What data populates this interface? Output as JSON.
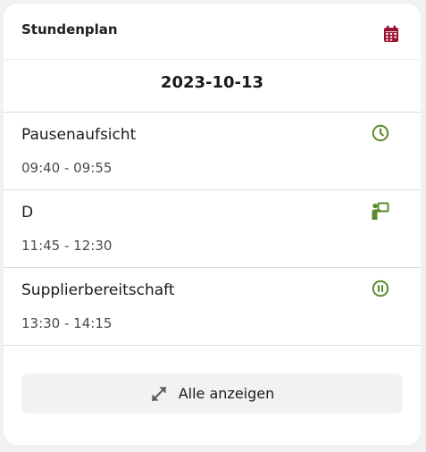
{
  "widget": {
    "title": "Stundenplan",
    "header_icon": "calendar-icon",
    "date": "2023-10-13"
  },
  "entries": [
    {
      "title": "Pausenaufsicht",
      "time": "09:40 - 09:55",
      "icon": "clock-icon"
    },
    {
      "title": "D",
      "time": "11:45 - 12:30",
      "icon": "teacher-board-icon"
    },
    {
      "title": "Supplierbereitschaft",
      "time": "13:30 - 14:15",
      "icon": "pause-circle-icon"
    }
  ],
  "footer": {
    "show_all_label": "Alle anzeigen",
    "icon": "expand-icon"
  },
  "colors": {
    "calendar_icon": "#9b1230",
    "entry_icon": "#5b8a2c",
    "button_background": "#f1f2f3"
  }
}
